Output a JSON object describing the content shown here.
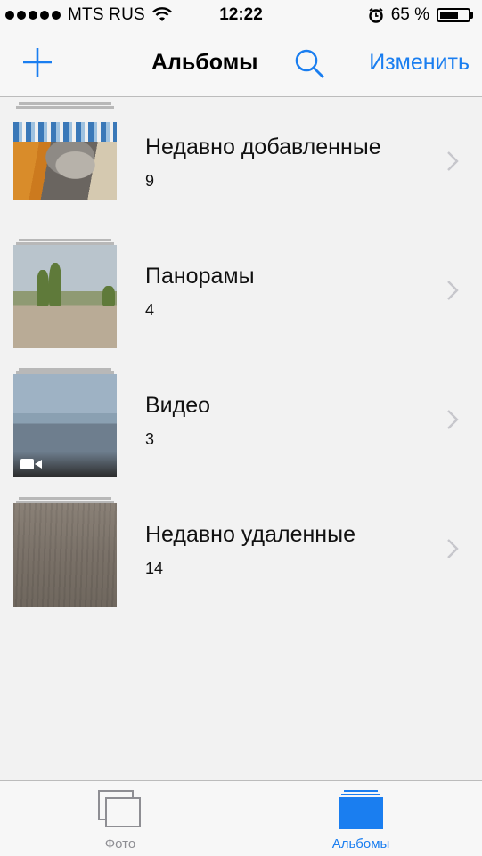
{
  "status_bar": {
    "carrier": "MTS RUS",
    "time": "12:22",
    "battery_percent": "65 %",
    "battery_level": 0.65,
    "icons": [
      "signal-dots",
      "wifi-icon",
      "alarm-icon",
      "battery-icon"
    ]
  },
  "nav": {
    "title": "Альбомы",
    "edit_label": "Изменить",
    "icons": {
      "add": "plus-icon",
      "search": "search-icon"
    }
  },
  "albums": [
    {
      "name": "Недавно добавленные",
      "count": "9",
      "thumbnail": "cat-photo"
    },
    {
      "name": "Панорамы",
      "count": "4",
      "thumbnail": "panorama-photo"
    },
    {
      "name": "Видео",
      "count": "3",
      "thumbnail": "video-frame"
    },
    {
      "name": "Недавно удаленные",
      "count": "14",
      "thumbnail": "wood-texture"
    }
  ],
  "tab_bar": {
    "photos_label": "Фото",
    "albums_label": "Альбомы",
    "active_tab": "albums"
  },
  "colors": {
    "accent": "#1a7ef0",
    "background": "#f2f2f2",
    "bar_background": "#f7f7f7",
    "inactive_tab": "#8e8e93",
    "chevron": "#c7c7cc"
  }
}
